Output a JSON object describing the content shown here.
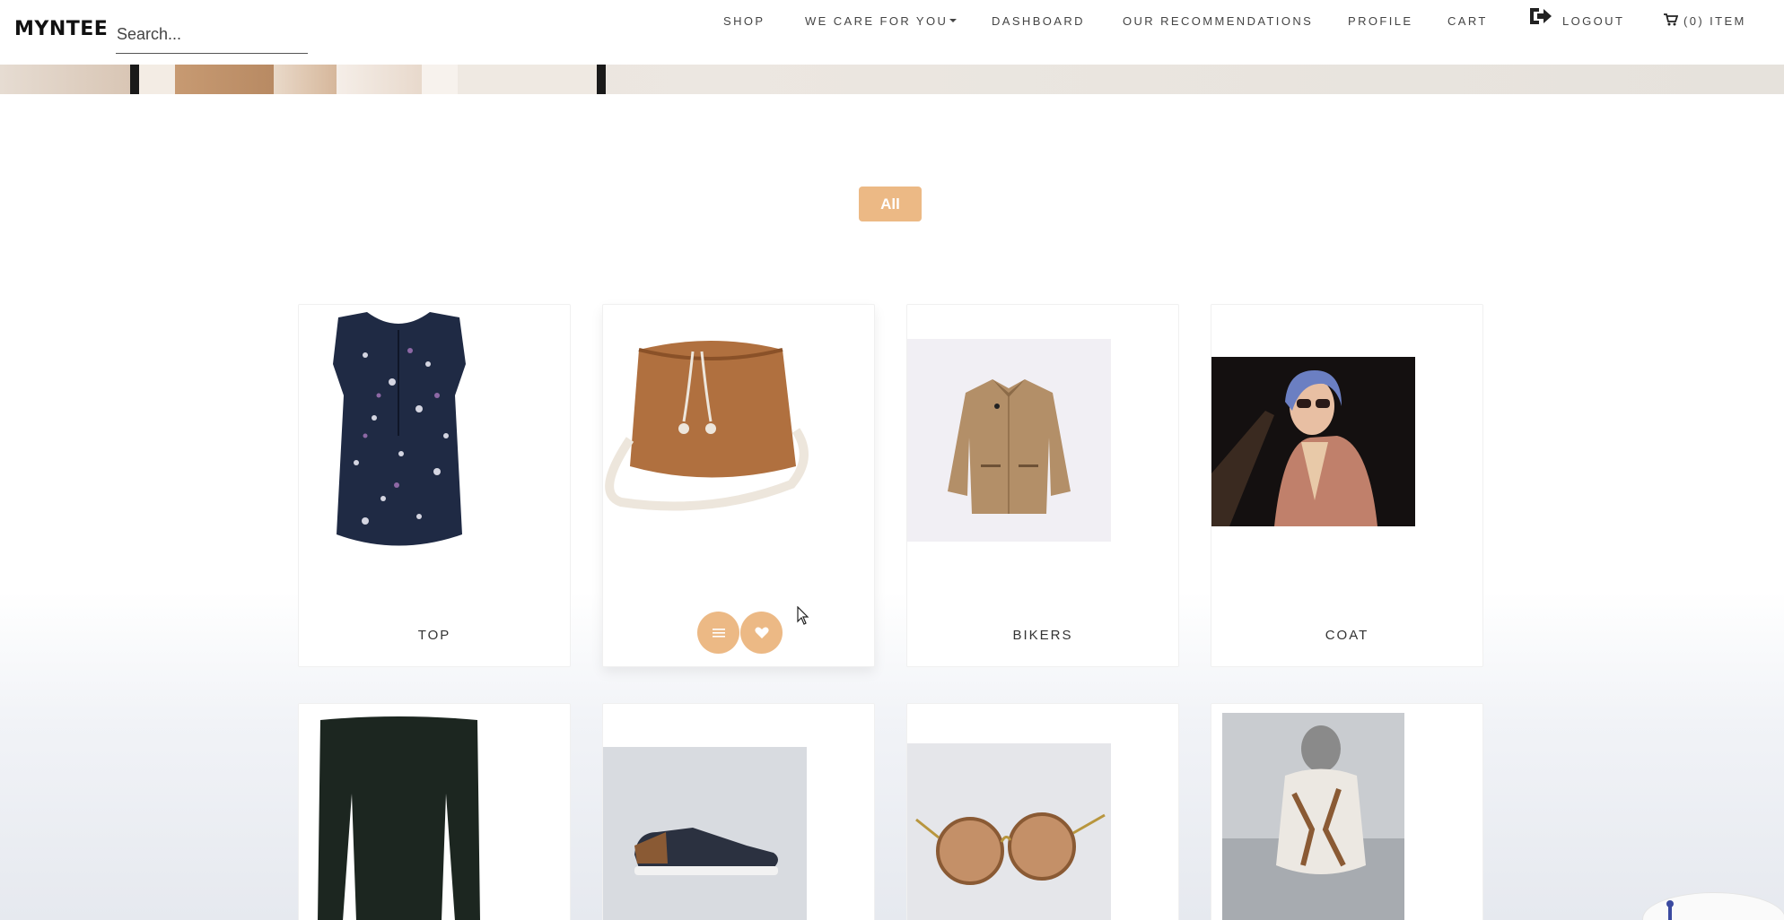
{
  "brand": "MYNTEE",
  "search": {
    "placeholder": "Search..."
  },
  "nav": {
    "shop": "SHOP",
    "we_care": "WE CARE FOR YOU",
    "dashboard": "DASHBOARD",
    "recommendations": "OUR RECOMMENDATIONS",
    "profile": "PROFILE",
    "cart": "CART",
    "logout": "LOGOUT",
    "cart_items": "(0) ITEM"
  },
  "filter": {
    "all_label": "All"
  },
  "products": [
    {
      "name": "TOP"
    },
    {
      "name": ""
    },
    {
      "name": "BIKERS"
    },
    {
      "name": "COAT"
    }
  ],
  "icons": {
    "logout": "logout-icon",
    "cart": "cart-icon",
    "details": "list-icon",
    "wishlist": "heart-icon"
  },
  "colors": {
    "accent": "#ecb985",
    "text": "#444444"
  }
}
